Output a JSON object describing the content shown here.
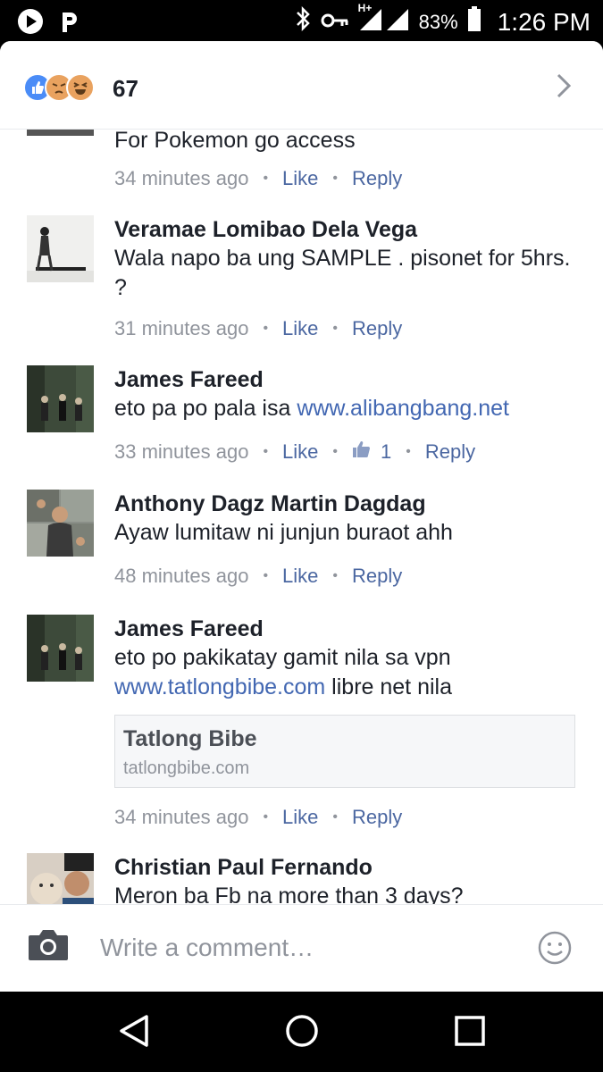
{
  "status_bar": {
    "signal_label": "H+",
    "battery": "83%",
    "time": "1:26 PM",
    "icons": [
      "play-app-icon",
      "p-app-icon",
      "bluetooth-icon",
      "vpn-key-icon",
      "signal-icon",
      "battery-icon"
    ]
  },
  "reactions": {
    "count": "67",
    "types": [
      "like",
      "angry",
      "haha"
    ],
    "colors": {
      "like": "#4a8cf7",
      "face": "#e9a25f"
    }
  },
  "comments": [
    {
      "name": "",
      "text": "For Pokemon go access",
      "time": "34 minutes ago",
      "like": "Like",
      "reply": "Reply"
    },
    {
      "name": "Veramae Lomibao Dela Vega",
      "text": "Wala napo ba ung SAMPLE . pisonet for 5hrs. ?",
      "time": "31 minutes ago",
      "like": "Like",
      "reply": "Reply"
    },
    {
      "name": "James Fareed",
      "text_pre": "eto pa po pala isa ",
      "link": "www.alibangbang.net",
      "time": "33 minutes ago",
      "like": "Like",
      "like_count": "1",
      "reply": "Reply"
    },
    {
      "name": "Anthony Dagz Martin Dagdag",
      "text": "Ayaw lumitaw ni junjun buraot ahh",
      "time": "48 minutes ago",
      "like": "Like",
      "reply": "Reply"
    },
    {
      "name": "James Fareed",
      "text_line1": "eto po pakikatay gamit nila sa vpn",
      "link": "www.tatlongbibe.com",
      "text_post": " libre net nila",
      "preview_title": "Tatlong Bibe",
      "preview_domain": "tatlongbibe.com",
      "time": "34 minutes ago",
      "like": "Like",
      "reply": "Reply"
    },
    {
      "name": "Christian Paul Fernando",
      "text": "Meron ba Fb na more than 3 days?"
    }
  ],
  "composer": {
    "placeholder": "Write a comment…"
  },
  "colors": {
    "link": "#4267b2",
    "action": "#4b67a1",
    "meta": "#90949c",
    "text": "#1d2129"
  }
}
